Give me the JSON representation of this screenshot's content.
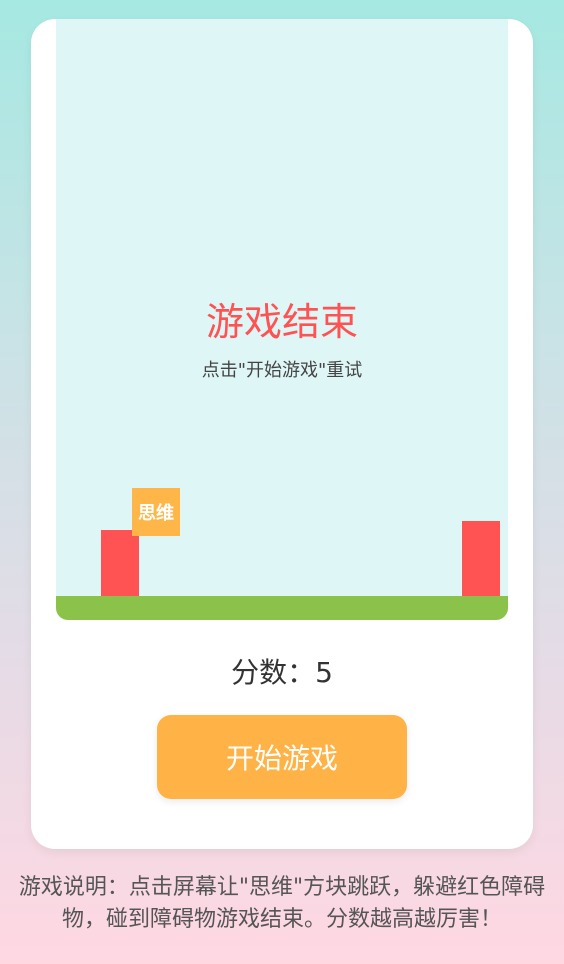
{
  "game": {
    "over_title": "游戏结束",
    "over_hint": "点击\"开始游戏\"重试",
    "player_label": "思维",
    "colors": {
      "sky": "#dff6f7",
      "ground": "#8bc34a",
      "obstacle": "#ff5252",
      "player": "#ffb648"
    }
  },
  "score": {
    "text": "分数：5"
  },
  "controls": {
    "start_label": "开始游戏",
    "accent": "#ffb245"
  },
  "instructions": {
    "text": "游戏说明：点击屏幕让\"思维\"方块跳跃，躲避红色障碍物，碰到障碍物游戏结束。分数越高越厉害！"
  }
}
